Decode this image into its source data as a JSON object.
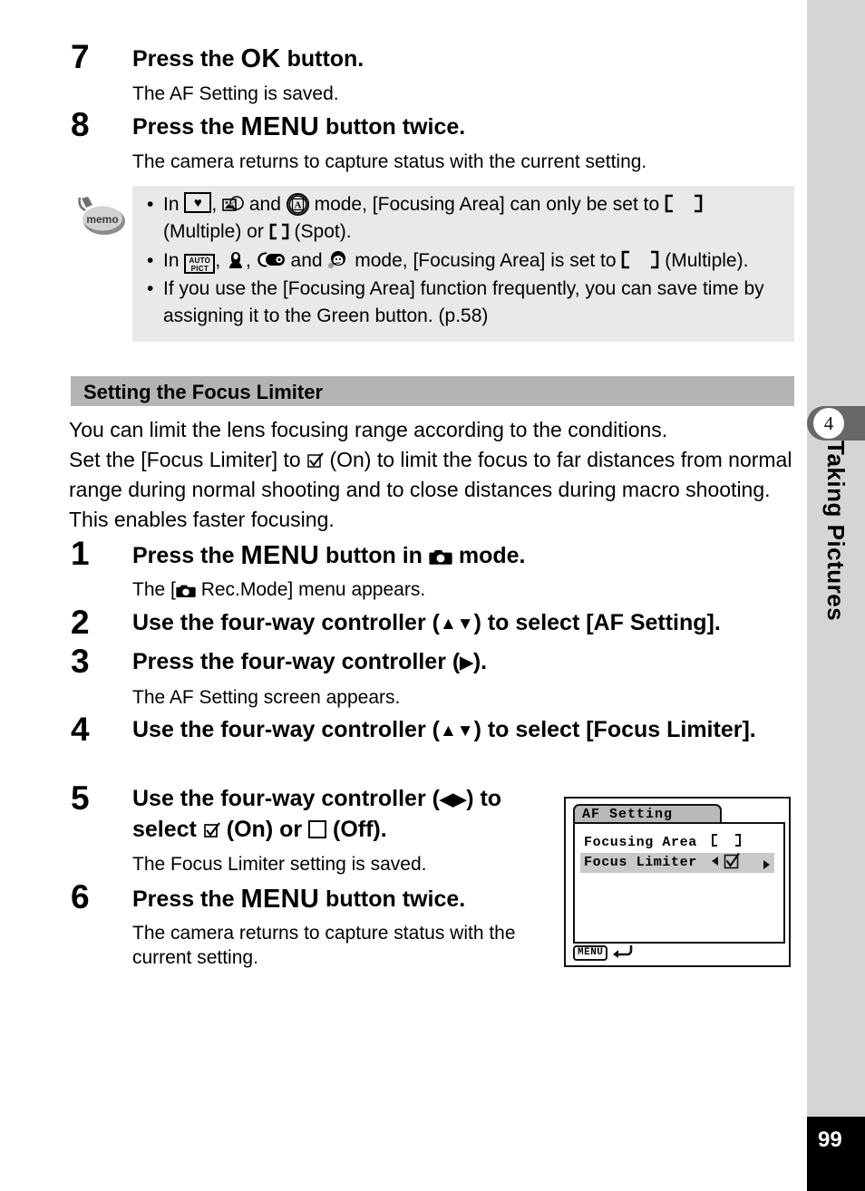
{
  "rail": {
    "chapter_number": "4",
    "chapter_title": "Taking Pictures",
    "page_number": "99"
  },
  "steps_top": [
    {
      "num": "7",
      "head_pre": "Press the ",
      "head_kw": "OK",
      "head_post": " button.",
      "body": "The AF Setting is saved."
    },
    {
      "num": "8",
      "head_pre": "Press the ",
      "head_kw": "MENU",
      "head_post": " button twice.",
      "body": "The camera returns to capture status with the current setting."
    }
  ],
  "memo": {
    "icon_label": "memo",
    "bullet": "•",
    "items": [
      {
        "t1": "In ",
        "t2": ", ",
        "t3": " and ",
        "t4": " mode, [Focusing Area] can only be set to ",
        "t5": " (Multiple) or ",
        "t6": " (Spot)."
      },
      {
        "t1": "In ",
        "t2": ", ",
        "t3": ", ",
        "t4": " and ",
        "t5": " mode, [Focusing Area] is set to ",
        "t6": " (Multiple)."
      },
      {
        "t1": "If you use the [Focusing Area] function frequently, you can save time by assigning it to the Green button. (p.58)"
      }
    ]
  },
  "section": {
    "heading": "Setting the Focus Limiter",
    "intro_line1": "You can limit the lens focusing range according to the conditions.",
    "intro_line2a": "Set the [Focus Limiter] to ",
    "intro_line2b": " (On) to limit the focus to far distances from normal range during normal shooting and to close distances during macro shooting. This enables faster focusing."
  },
  "steps_main": [
    {
      "num": "1",
      "head_a": "Press the ",
      "head_kw": "MENU",
      "head_b": " button in ",
      "head_c": " mode.",
      "body_a": "The [",
      "body_b": " Rec.Mode] menu appears."
    },
    {
      "num": "2",
      "head_a": "Use the four-way controller (",
      "head_arrows": "▲▼",
      "head_b": ") to select [AF Setting].",
      "body": ""
    },
    {
      "num": "3",
      "head_a": "Press the four-way controller (",
      "head_arrows": "▶",
      "head_b": ").",
      "body": "The AF Setting screen appears."
    },
    {
      "num": "4",
      "head_a": "Use the four-way controller (",
      "head_arrows": "▲▼",
      "head_b": ") to select [Focus Limiter].",
      "body": ""
    },
    {
      "num": "5",
      "head_a": "Use the four-way controller (",
      "head_arrows": "◀▶",
      "head_b": ") to select ",
      "head_c": " (On) or ",
      "head_d": " (Off).",
      "body": "The Focus Limiter setting is saved."
    },
    {
      "num": "6",
      "head_a": "Press the ",
      "head_kw": "MENU",
      "head_b": " button twice.",
      "body": "The camera returns to capture status with the current setting."
    }
  ],
  "lcd": {
    "title": "AF Setting",
    "rows": [
      {
        "label": "Focusing Area",
        "value_type": "bracket-wide"
      },
      {
        "label": "Focus Limiter",
        "value_type": "checkbox-checked"
      }
    ],
    "menu_key": "MENU",
    "back_arrow": "↩"
  },
  "colors": {
    "rail_bg": "#d5d5d5",
    "tab_bg": "#686868",
    "memo_bg": "#e9e9e9",
    "band_bg": "#b4b4b4",
    "lcd_highlight": "#c9c9c9"
  }
}
